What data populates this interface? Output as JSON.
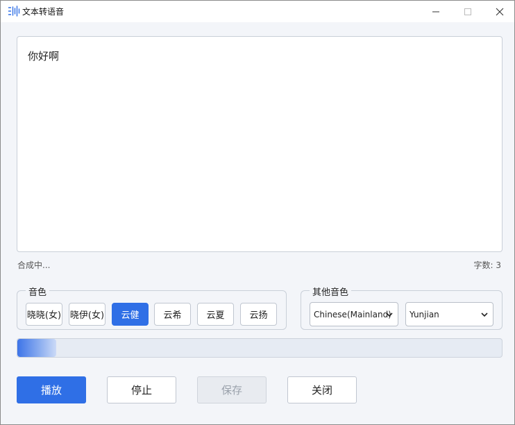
{
  "window": {
    "title": "文本转语音",
    "controls": {
      "minimize": "minimize-icon",
      "maximize": "maximize-icon",
      "close": "close-icon"
    }
  },
  "editor": {
    "text": "你好啊"
  },
  "status": {
    "message": "合成中...",
    "char_count": "字数: 3"
  },
  "voice_group": {
    "label": "音色",
    "voices": [
      {
        "label": "晓晓(女)",
        "selected": false
      },
      {
        "label": "晓伊(女)",
        "selected": false
      },
      {
        "label": "云健",
        "selected": true
      },
      {
        "label": "云希",
        "selected": false
      },
      {
        "label": "云夏",
        "selected": false
      },
      {
        "label": "云扬",
        "selected": false
      }
    ]
  },
  "other_group": {
    "label": "其他音色",
    "language_select": {
      "value": "Chinese(Mainland)"
    },
    "voice_select": {
      "value": "Yunjian"
    }
  },
  "progress": {
    "value_percent": 8
  },
  "actions": {
    "play_label": "播放",
    "stop_label": "停止",
    "save_label": "保存",
    "close_label": "关闭"
  },
  "colors": {
    "accent": "#2f6fe6",
    "background": "#f3f5f9",
    "disabled_text": "#9aa1ab"
  }
}
